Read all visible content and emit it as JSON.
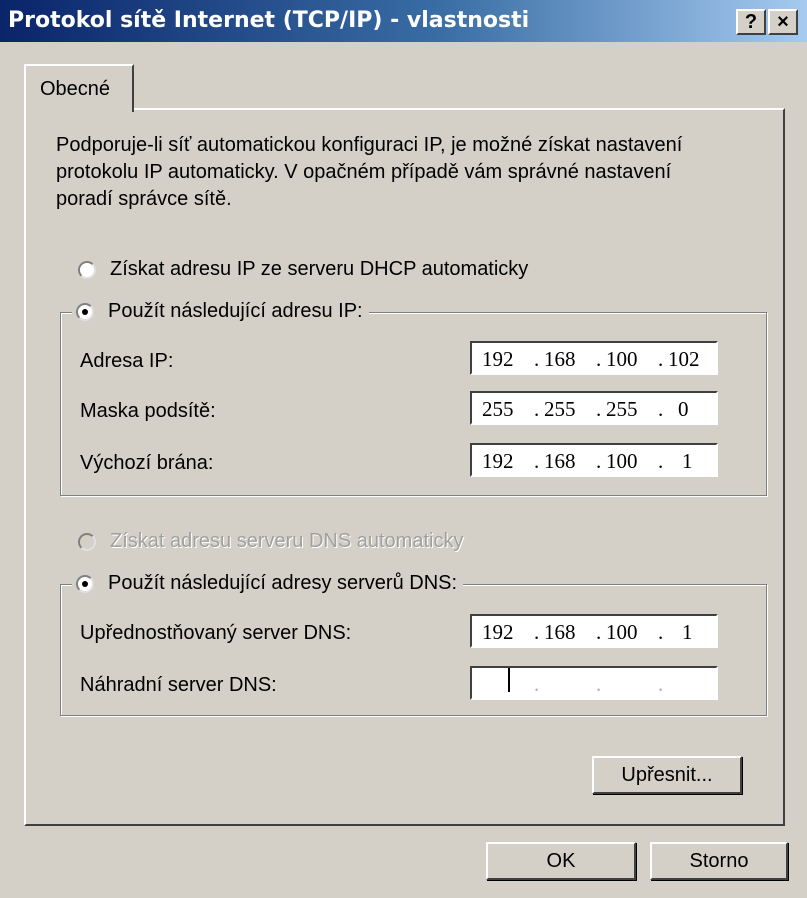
{
  "window": {
    "title": "Protokol sítě Internet (TCP/IP) - vlastnosti",
    "help_button": "?",
    "close_button": "×"
  },
  "tabs": [
    {
      "label": "Obecné",
      "selected": true
    }
  ],
  "intro": {
    "line1": "Podporuje-li síť automatickou konfiguraci IP, je možné získat nastavení",
    "line2": "protokolu IP automaticky. V opačném případě vám správné nastavení",
    "line3": "poradí správce sítě."
  },
  "ip_section": {
    "auto_option": {
      "label": "Získat adresu IP ze serveru DHCP automaticky",
      "selected": false
    },
    "manual_option": {
      "label": "Použít následující adresu IP:",
      "selected": true
    },
    "fields": [
      {
        "label": "Adresa IP:",
        "octets": [
          "192",
          "168",
          "100",
          "102"
        ]
      },
      {
        "label": "Maska podsítě:",
        "octets": [
          "255",
          "255",
          "255",
          "0"
        ]
      },
      {
        "label": "Výchozí brána:",
        "octets": [
          "192",
          "168",
          "100",
          "1"
        ]
      }
    ]
  },
  "dns_section": {
    "auto_option": {
      "label": "Získat adresu serveru DNS automaticky",
      "selected": false,
      "disabled": true
    },
    "manual_option": {
      "label": "Použít následující adresy serverů DNS:",
      "selected": true
    },
    "fields": [
      {
        "label": "Upřednostňovaný server DNS:",
        "octets": [
          "192",
          "168",
          "100",
          "1"
        ]
      },
      {
        "label": "Náhradní server DNS:",
        "octets": [
          "",
          "",
          "",
          ""
        ]
      }
    ]
  },
  "buttons": {
    "advanced": "Upřesnit...",
    "ok": "OK",
    "cancel": "Storno"
  },
  "colors": {
    "dialog_bg": "#d4d0c8",
    "title_gradient_start": "#0a246a",
    "title_gradient_end": "#a6caf0",
    "disabled_text": "#a0a0a0"
  }
}
